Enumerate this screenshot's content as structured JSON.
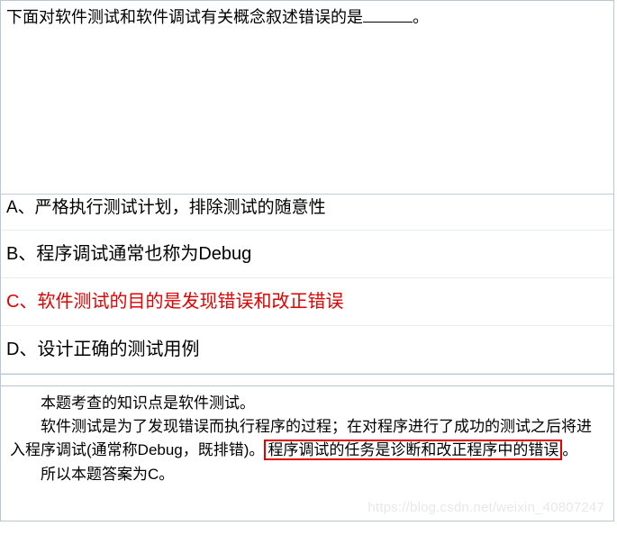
{
  "question": {
    "stem_prefix": "下面对软件测试和软件调试有关概念叙述错误的是",
    "stem_suffix": "。"
  },
  "options": {
    "a": "A、严格执行测试计划，排除测试的随意性",
    "b": "B、程序调试通常也称为Debug",
    "c": "C、软件测试的目的是发现错误和改正错误",
    "d": "D、设计正确的测试用例"
  },
  "explanation": {
    "line1": "本题考查的知识点是软件测试。",
    "line2a": "软件测试是为了发现错误而执行程序的过程；在对程序进行了成功的测试之后将进入程序调试(通常称Debug，既排错)。",
    "line2_hl": "程序调试的任务是诊断和改正程序中的错误",
    "line2_end": "。",
    "line3": "所以本题答案为C。"
  },
  "watermark": "https://blog.csdn.net/weixin_40807247"
}
